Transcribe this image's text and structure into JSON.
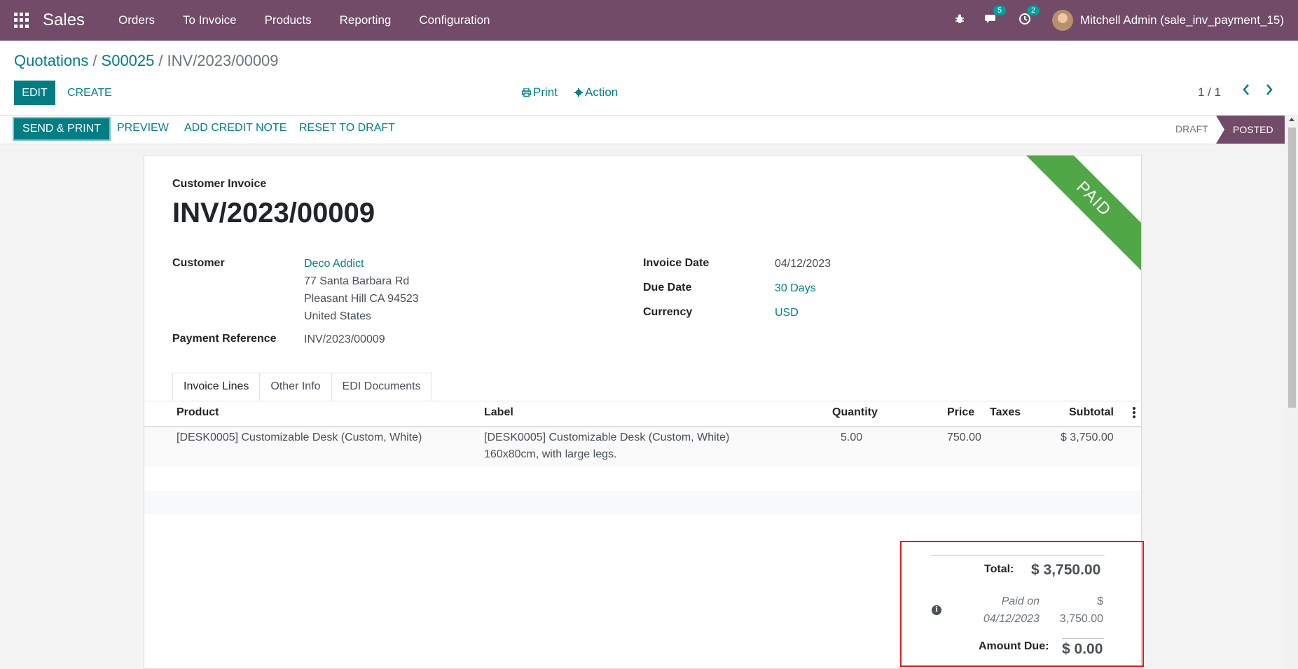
{
  "navbar": {
    "app_name": "Sales",
    "menu": [
      "Orders",
      "To Invoice",
      "Products",
      "Reporting",
      "Configuration"
    ],
    "messages_badge": "5",
    "activities_badge": "2",
    "user_name": "Mitchell Admin (sale_inv_payment_15)"
  },
  "breadcrumb": {
    "items": [
      "Quotations",
      "S00025",
      "INV/2023/00009"
    ],
    "separator": "/"
  },
  "control": {
    "edit_label": "EDIT",
    "create_label": "CREATE",
    "print_label": "Print",
    "action_label": "Action",
    "pager": "1 / 1"
  },
  "statusbar": {
    "buttons": [
      "SEND & PRINT",
      "PREVIEW",
      "ADD CREDIT NOTE",
      "RESET TO DRAFT"
    ],
    "states": [
      "DRAFT",
      "POSTED"
    ],
    "active_state": "POSTED"
  },
  "invoice": {
    "ribbon": "PAID",
    "doc_type": "Customer Invoice",
    "name": "INV/2023/00009",
    "fields": {
      "customer_label": "Customer",
      "customer_name": "Deco Addict",
      "address": [
        "77 Santa Barbara Rd",
        "Pleasant Hill CA 94523",
        "United States"
      ],
      "payment_ref_label": "Payment Reference",
      "payment_ref": "INV/2023/00009",
      "invoice_date_label": "Invoice Date",
      "invoice_date": "04/12/2023",
      "due_date_label": "Due Date",
      "due_date": "30 Days",
      "currency_label": "Currency",
      "currency": "USD"
    },
    "tabs": [
      "Invoice Lines",
      "Other Info",
      "EDI Documents"
    ],
    "active_tab": "Invoice Lines",
    "table": {
      "headers": [
        "Product",
        "Label",
        "Quantity",
        "Price",
        "Taxes",
        "Subtotal"
      ],
      "rows": [
        {
          "product": "[DESK0005] Customizable Desk (Custom, White)",
          "label_line1": "[DESK0005] Customizable Desk (Custom, White)",
          "label_line2": "160x80cm, with large legs.",
          "quantity": "5.00",
          "price": "750.00",
          "taxes": "",
          "subtotal": "$ 3,750.00"
        }
      ]
    },
    "totals": {
      "total_label": "Total:",
      "total_value": "$ 3,750.00",
      "paid_label_line1": "Paid on",
      "paid_label_line2": "04/12/2023",
      "paid_value_line1": "$",
      "paid_value_line2": "3,750.00",
      "amount_due_label": "Amount Due:",
      "amount_due_value": "$ 0.00"
    }
  },
  "colors": {
    "navbar": "#714b67",
    "primary": "#017e84",
    "ribbon": "#4fa845",
    "highlight_border": "#e01b1b"
  }
}
